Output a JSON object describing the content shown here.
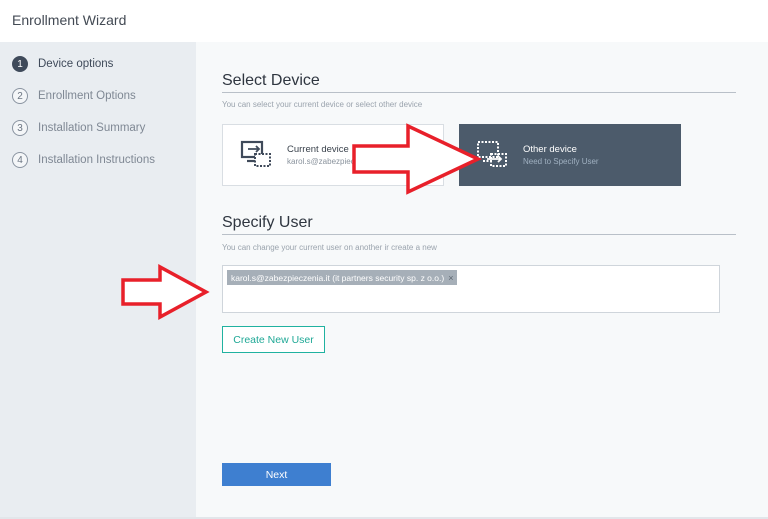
{
  "header": {
    "title": "Enrollment Wizard"
  },
  "steps": [
    {
      "num": "1",
      "label": "Device options",
      "active": true
    },
    {
      "num": "2",
      "label": "Enrollment Options",
      "active": false
    },
    {
      "num": "3",
      "label": "Installation Summary",
      "active": false
    },
    {
      "num": "4",
      "label": "Installation Instructions",
      "active": false
    }
  ],
  "select_device": {
    "title": "Select Device",
    "subtitle": "You can select your current device or select other device",
    "current": {
      "name": "Current device",
      "sub": "karol.s@zabezpieczenia.it",
      "icon": "current-device-icon"
    },
    "other": {
      "name": "Other device",
      "sub": "Need to Specify User",
      "icon": "other-device-icon"
    }
  },
  "specify_user": {
    "title": "Specify User",
    "subtitle": "You can change your current user on another ir create a new",
    "selected_user": "karol.s@zabezpieczenia.it (it partners security sp. z o.o.)",
    "remove_glyph": "×"
  },
  "buttons": {
    "create_new_user": "Create New User",
    "next": "Next"
  },
  "colors": {
    "sidebar_bg": "#e9edf1",
    "selected_card": "#4c5b6b",
    "next_button": "#3e7fd0",
    "create_button": "#20b2a0",
    "annotation_arrow": "#e8202a"
  }
}
